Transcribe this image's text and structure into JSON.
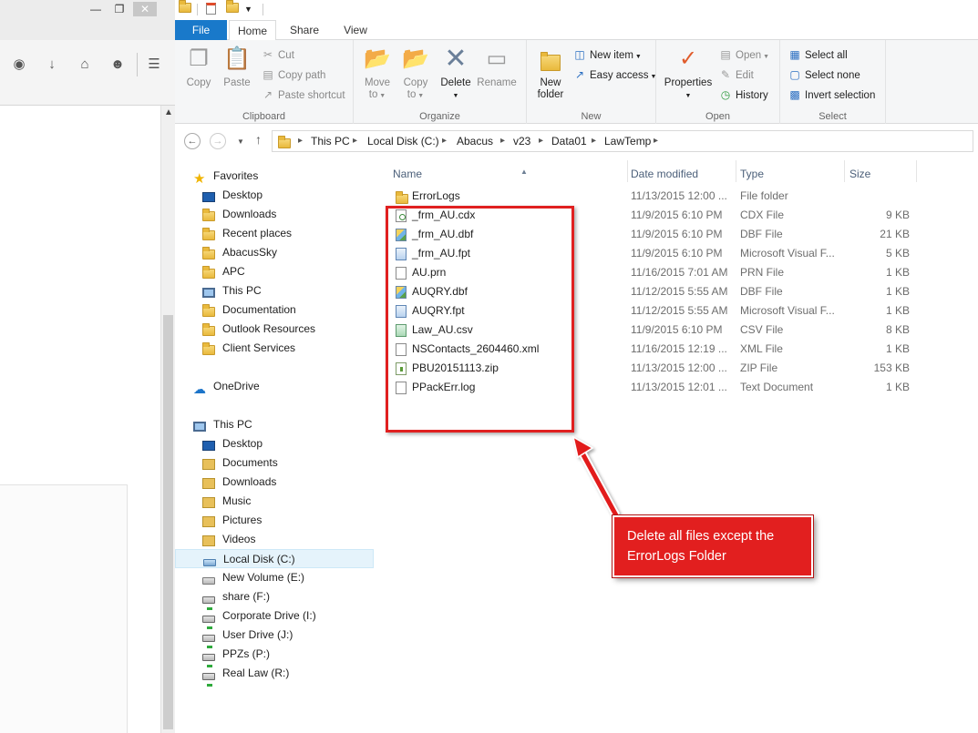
{
  "explorer": {
    "tabs": [
      "File",
      "Home",
      "Share",
      "View"
    ],
    "clipboard": {
      "label": "Clipboard",
      "copy": "Copy",
      "paste": "Paste",
      "cut": "Cut",
      "copy_path": "Copy path",
      "paste_shortcut": "Paste shortcut"
    },
    "organize": {
      "label": "Organize",
      "move_to": [
        "Move",
        "to"
      ],
      "copy_to": [
        "Copy",
        "to"
      ],
      "delete": "Delete",
      "rename": "Rename"
    },
    "new": {
      "label": "New",
      "new_folder": [
        "New",
        "folder"
      ],
      "new_item": "New item",
      "easy_access": "Easy access"
    },
    "open": {
      "label": "Open",
      "properties": "Properties",
      "open": "Open",
      "edit": "Edit",
      "history": "History"
    },
    "select": {
      "label": "Select",
      "select_all": "Select all",
      "select_none": "Select none",
      "invert_selection": "Invert selection"
    },
    "address": [
      "This PC",
      "Local Disk (C:)",
      "Abacus",
      "v23",
      "Data01",
      "LawTemp"
    ],
    "nav": {
      "favorites_header": "Favorites",
      "favorites": [
        "Desktop",
        "Downloads",
        "Recent places",
        "AbacusSky",
        "APC",
        "This PC",
        "Documentation",
        "Outlook Resources",
        "Client Services"
      ],
      "onedrive": "OneDrive",
      "thispc_header": "This PC",
      "thispc": [
        "Desktop",
        "Documents",
        "Downloads",
        "Music",
        "Pictures",
        "Videos"
      ],
      "drives": [
        "Local Disk (C:)",
        "New Volume (E:)",
        "share (F:)",
        "Corporate Drive (I:)",
        "User Drive (J:)",
        "PPZs (P:)",
        "Real Law (R:)"
      ]
    },
    "columns": {
      "name": "Name",
      "date": "Date modified",
      "type": "Type",
      "size": "Size"
    },
    "files": [
      {
        "name": "ErrorLogs",
        "date": "11/13/2015 12:00 ...",
        "type": "File folder",
        "size": "",
        "icon": "folder"
      },
      {
        "name": "_frm_AU.cdx",
        "date": "11/9/2015 6:10 PM",
        "type": "CDX File",
        "size": "9 KB",
        "icon": "cdx"
      },
      {
        "name": "_frm_AU.dbf",
        "date": "11/9/2015 6:10 PM",
        "type": "DBF File",
        "size": "21 KB",
        "icon": "db"
      },
      {
        "name": "_frm_AU.fpt",
        "date": "11/9/2015 6:10 PM",
        "type": "Microsoft Visual F...",
        "size": "5 KB",
        "icon": "fpt"
      },
      {
        "name": "AU.prn",
        "date": "11/16/2015 7:01 AM",
        "type": "PRN File",
        "size": "1 KB",
        "icon": "blank"
      },
      {
        "name": "AUQRY.dbf",
        "date": "11/12/2015 5:55 AM",
        "type": "DBF File",
        "size": "1 KB",
        "icon": "db"
      },
      {
        "name": "AUQRY.fpt",
        "date": "11/12/2015 5:55 AM",
        "type": "Microsoft Visual F...",
        "size": "1 KB",
        "icon": "fpt"
      },
      {
        "name": "Law_AU.csv",
        "date": "11/9/2015 6:10 PM",
        "type": "CSV File",
        "size": "8 KB",
        "icon": "csv"
      },
      {
        "name": "NSContacts_2604460.xml",
        "date": "11/16/2015 12:19 ...",
        "type": "XML File",
        "size": "1 KB",
        "icon": "blank"
      },
      {
        "name": "PBU20151113.zip",
        "date": "11/13/2015 12:00 ...",
        "type": "ZIP File",
        "size": "153 KB",
        "icon": "zip"
      },
      {
        "name": "PPackErr.log",
        "date": "11/13/2015 12:01 ...",
        "type": "Text Document",
        "size": "1 KB",
        "icon": "blank"
      }
    ]
  },
  "annotation": {
    "line1": "Delete all files except the",
    "line2": "ErrorLogs Folder",
    "color": "#e21f1f"
  }
}
